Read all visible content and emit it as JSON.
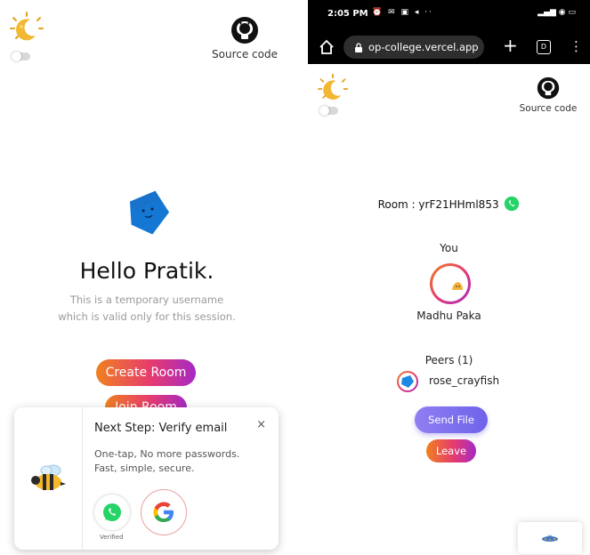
{
  "left": {
    "github_label": "Source code",
    "greeting": "Hello Pratik.",
    "subtitle_line1": "This is a temporary username",
    "subtitle_line2": "which is valid only for this session.",
    "create_room_label": "Create Room",
    "join_room_label": "Join Room",
    "verify_card": {
      "title": "Next Step: Verify email",
      "close_label": "×",
      "line1": "One-tap, No more passwords.",
      "line2": "Fast, simple, secure.",
      "whatsapp_caption": "Verified"
    }
  },
  "right": {
    "status_bar": {
      "time": "2:05 PM",
      "indicators": "⏰ ✉ ▣ ◂ ··",
      "right_indicators": "▂▄▆ ◉ ▭"
    },
    "browser": {
      "url": "op-college.vercel.app",
      "home_icon": "home-icon",
      "plus_label": "+",
      "tabs_count": "D",
      "menu_label": "⋮"
    },
    "github_label": "Source code",
    "room_label": "Room : yrF21HHml853",
    "you_label": "You",
    "you_name": "Madhu Paka",
    "peers_label": "Peers (1)",
    "peer_name": "rose_crayfish",
    "send_file_label": "Send File",
    "leave_label": "Leave"
  },
  "colors": {
    "gradient_start": "#f0801f",
    "gradient_mid": "#e63b6f",
    "gradient_end": "#a529c5",
    "send_file": "#7b6ef0",
    "whatsapp": "#25d366",
    "avatar_blue": "#1e88e5"
  },
  "icons": [
    "moon-icon",
    "github-icon",
    "whatsapp-icon",
    "google-icon",
    "bee-icon",
    "ufo-icon",
    "lock-icon",
    "home-icon"
  ]
}
